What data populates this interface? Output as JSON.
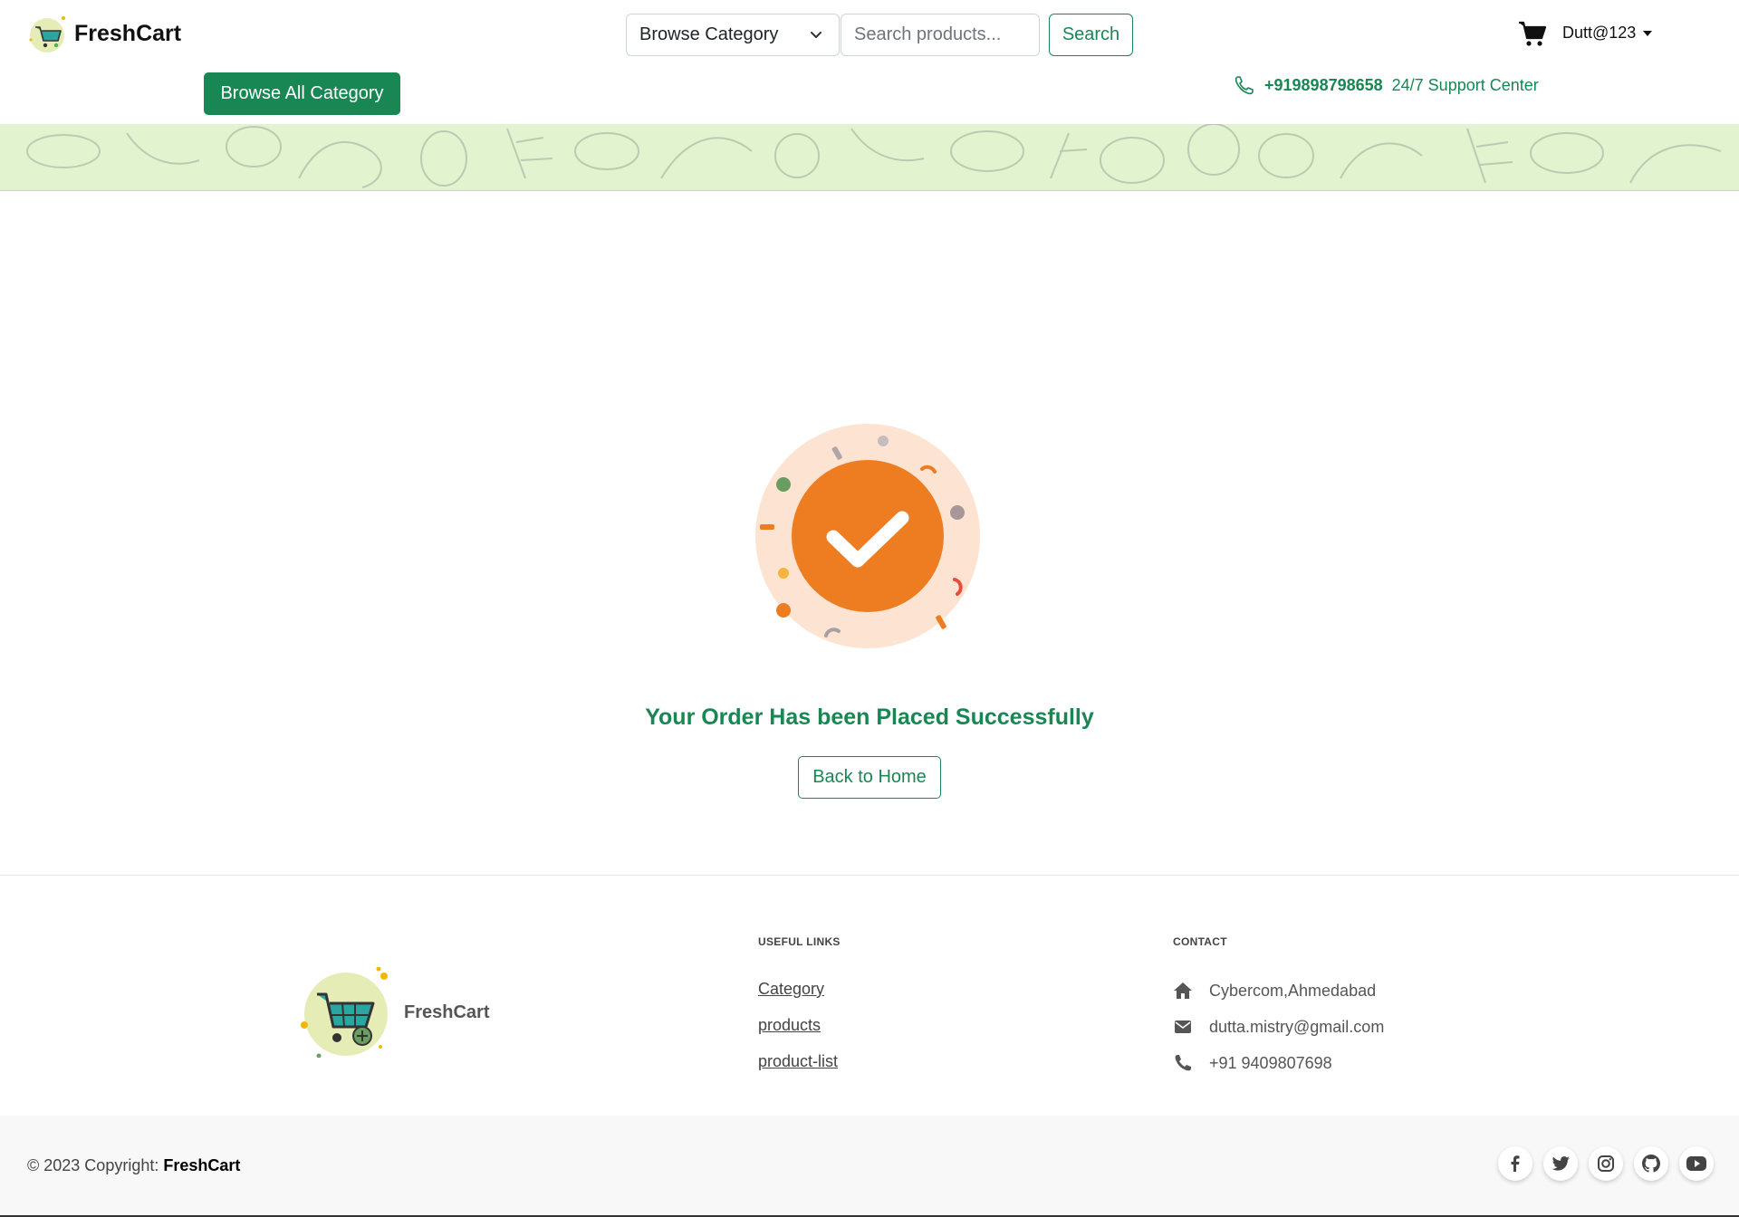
{
  "header": {
    "brand": "FreshCart",
    "category_select": "Browse Category",
    "search_placeholder": "Search products...",
    "search_button": "Search",
    "user": "Dutt@123",
    "browse_all": "Browse All Category",
    "support_phone": "+919898798658",
    "support_label": "24/7 Support Center"
  },
  "main": {
    "message": "Your Order Has been Placed Successfully",
    "back_home": "Back to Home"
  },
  "footer": {
    "brand": "FreshCart",
    "useful_links_title": "USEFUL LINKS",
    "links": [
      "Category",
      "products",
      "product-list"
    ],
    "contact_title": "CONTACT",
    "address": "Cybercom,Ahmedabad",
    "email": "dutta.mistry@gmail.com",
    "phone": "+91 9409807698",
    "copyright_prefix": "© 2023 Copyright: ",
    "copyright_brand": "FreshCart",
    "socials": [
      "facebook-icon",
      "twitter-icon",
      "instagram-icon",
      "github-icon",
      "youtube-icon"
    ]
  },
  "colors": {
    "primary": "#198754",
    "success_orange": "#ee7d22",
    "success_halo": "#fde3d2",
    "banner_bg": "#e1f4cf"
  }
}
